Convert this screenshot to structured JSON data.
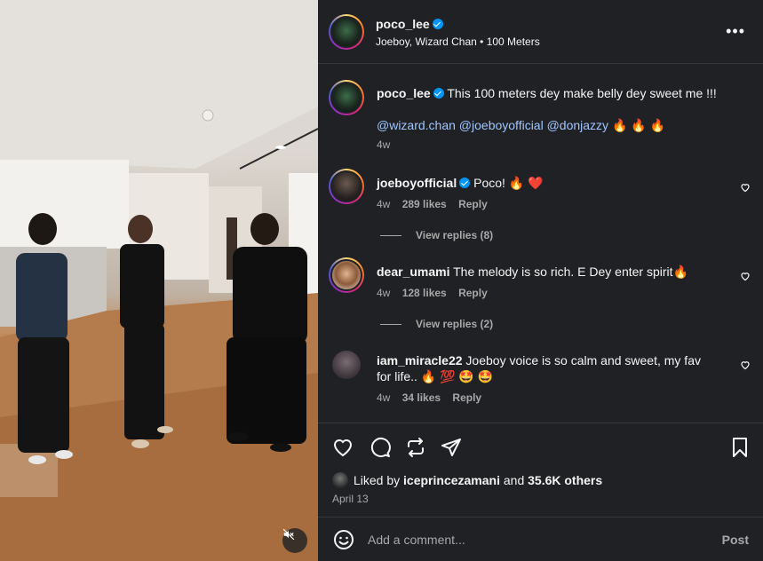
{
  "post": {
    "author": "poco_lee",
    "subtitle": "Joeboy, Wizard Chan • 100 Meters",
    "caption": {
      "username": "poco_lee",
      "text": "This 100 meters dey make belly dey sweet me !!!",
      "mentions": "@wizard.chan @joeboyofficial @donjazzy",
      "emojis": "🔥 🔥 🔥",
      "time": "4w"
    }
  },
  "comments": [
    {
      "username": "joeboyofficial",
      "text": "Poco! 🔥 ❤️",
      "time": "4w",
      "likes": "289 likes",
      "reply": "Reply",
      "view_replies": "View replies (8)"
    },
    {
      "username": "dear_umami",
      "text": "The melody is so rich. E Dey enter spirit🔥",
      "time": "4w",
      "likes": "128 likes",
      "reply": "Reply",
      "view_replies": "View replies (2)"
    },
    {
      "username": "iam_miracle22",
      "text": "Joeboy voice is so calm and sweet, my fav for life.. 🔥 💯 🤩 🤩",
      "time": "4w",
      "likes": "34 likes",
      "reply": "Reply"
    }
  ],
  "likes": {
    "prefix": "Liked by",
    "user": "iceprincezamani",
    "conj": "and",
    "others": "35.6K others"
  },
  "date": "April 13",
  "composer": {
    "placeholder": "Add a comment...",
    "post_label": "Post"
  },
  "icons": {
    "more": "more-options-icon",
    "like": "heart-icon",
    "comment": "comment-icon",
    "repost": "repost-icon",
    "share": "send-icon",
    "save": "bookmark-icon",
    "emoji": "emoji-icon",
    "mute": "muted-speaker-icon"
  },
  "colors": {
    "panel_bg": "#202124",
    "verified": "#0095f6",
    "mention": "#9fc5ff",
    "secondary_text": "#a8a8a8"
  }
}
